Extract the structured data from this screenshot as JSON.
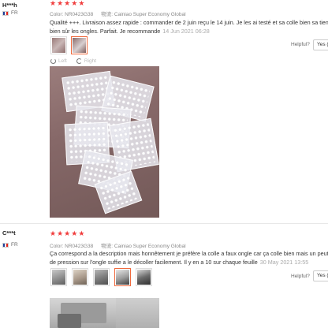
{
  "reviews": [
    {
      "user": "H***h",
      "country": "FR",
      "stars": 5,
      "color": "Color: NR0423G38",
      "shipping_icon": "shipping-logo",
      "shipping_label": "物流: Cainiao Super Economy Global",
      "text": "Qualité +++. Livraison assez rapide : commander de 2 juin reçu le 14 juin. Je les ai testé et sa colle bien sa tien bien sûr les ongles. Parfait. Je recommande",
      "date": "14 Jun 2021 06:28",
      "helpful_label": "Helpful?",
      "yes_label": "Yes (",
      "rotate_left": "Left",
      "rotate_right": "Right",
      "thumbnails": 2,
      "active_thumbnail": 2
    },
    {
      "user": "C***t",
      "country": "FR",
      "stars": 5,
      "color": "Color: NR0423G38",
      "shipping_icon": "shipping-logo",
      "shipping_label": "物流: Cainiao Super Economy Global",
      "text": "Ça correspond a la description mais honnêtement je préfère la colle a faux ongle car ça colle bien mais un peut de pression sur l'ongle suffie a le décoller facilement. Il y en a 10 sur chaque feuille",
      "date": "30 May 2021 13:55",
      "helpful_label": "Helpful?",
      "yes_label": "Yes (",
      "thumbnails": 5,
      "active_thumbnail": 4
    }
  ],
  "colors": {
    "star": "#f03d3d",
    "active_thumb_border": "#f06a3e",
    "photo_bg": "#866868"
  }
}
